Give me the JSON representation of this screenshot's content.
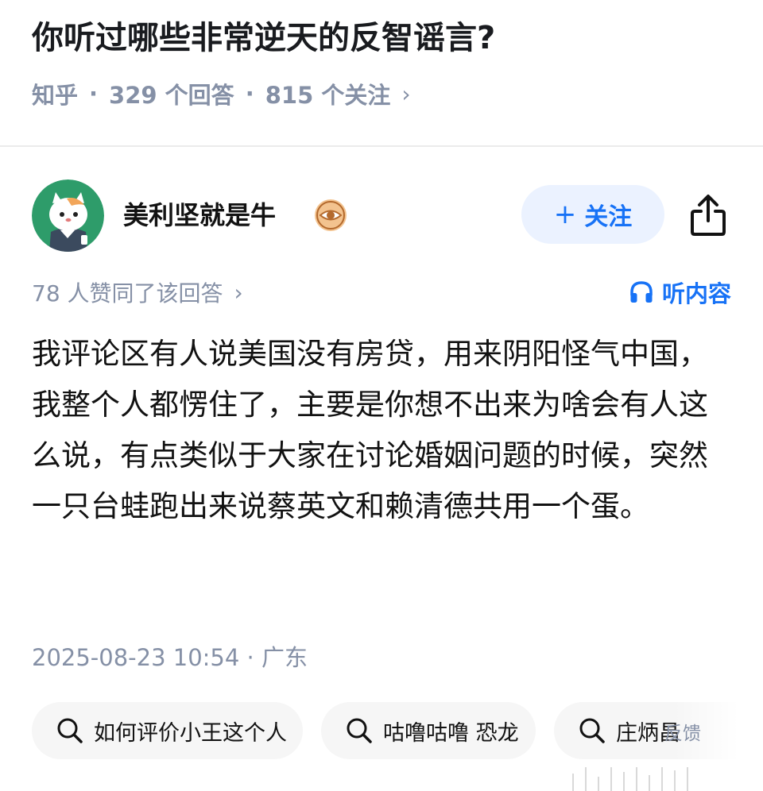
{
  "question": {
    "title": "你听过哪些非常逆天的反智谣言?",
    "source": "知乎",
    "answers": "329 个回答",
    "followers": "815 个关注",
    "separator": "·",
    "chevron": "›"
  },
  "author": {
    "name": "美利坚就是牛",
    "avatar_icon": "cartoon-cat-avatar",
    "badge_icon": "eye-badge-icon",
    "follow_label": "关注",
    "follow_plus": "+",
    "share_icon": "share-icon"
  },
  "answer": {
    "votes": "78 人赞同了该回答",
    "votes_chevron": "›",
    "listen_label": "听内容",
    "body": "我评论区有人说美国没有房贷，用来阴阳怪气中国，我整个人都愣住了，主要是你想不出来为啥会有人这么说，有点类似于大家在讨论婚姻问题的时候，突然一只台蛙跑出来说蔡英文和赖清德共用一个蛋。",
    "timestamp": "2025-08-23 10:54 · 广东"
  },
  "related_searches": [
    {
      "label": "如何评价小王这个人"
    },
    {
      "label": "咕噜咕噜 恐龙"
    },
    {
      "label": "庄炳昌"
    }
  ],
  "feedback_label": "反馈",
  "colors": {
    "accent": "#1772f6",
    "muted": "#8590a6",
    "follow_bg": "#ebf2ff",
    "avatar_bg": "#2e9c6a"
  }
}
